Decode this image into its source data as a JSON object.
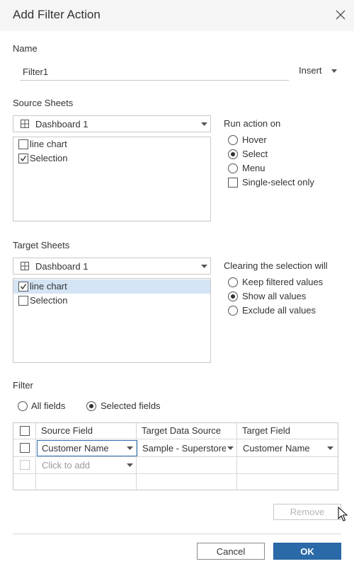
{
  "dialog": {
    "title": "Add Filter Action"
  },
  "name_section": {
    "label": "Name",
    "value": "Filter1",
    "insert_label": "Insert"
  },
  "source": {
    "label": "Source Sheets",
    "dropdown_value": "Dashboard 1",
    "sheets": [
      {
        "label": "line chart",
        "checked": false
      },
      {
        "label": "Selection",
        "checked": true
      }
    ]
  },
  "run_action": {
    "label": "Run action on",
    "options": [
      {
        "label": "Hover",
        "selected": false
      },
      {
        "label": "Select",
        "selected": true
      },
      {
        "label": "Menu",
        "selected": false
      }
    ],
    "single_select_label": "Single-select only",
    "single_select_checked": false
  },
  "target": {
    "label": "Target Sheets",
    "dropdown_value": "Dashboard 1",
    "sheets": [
      {
        "label": "line chart",
        "checked": true,
        "highlighted": true
      },
      {
        "label": "Selection",
        "checked": false,
        "highlighted": false
      }
    ]
  },
  "clearing": {
    "label": "Clearing the selection will",
    "options": [
      {
        "label": "Keep filtered values",
        "selected": false
      },
      {
        "label": "Show all values",
        "selected": true
      },
      {
        "label": "Exclude all values",
        "selected": false
      }
    ]
  },
  "filter": {
    "label": "Filter",
    "all_fields_label": "All fields",
    "selected_fields_label": "Selected fields",
    "mode": "selected",
    "columns": [
      "Source Field",
      "Target Data Source",
      "Target Field"
    ],
    "rows": [
      {
        "source_field": "Customer Name",
        "target_source": "Sample - Superstore",
        "target_field": "Customer Name"
      }
    ],
    "add_placeholder": "Click to add"
  },
  "buttons": {
    "remove": "Remove",
    "cancel": "Cancel",
    "ok": "OK"
  },
  "colors": {
    "accent": "#2b6aa8",
    "selection": "#d4e4f4",
    "border": "#c8c8c8"
  }
}
